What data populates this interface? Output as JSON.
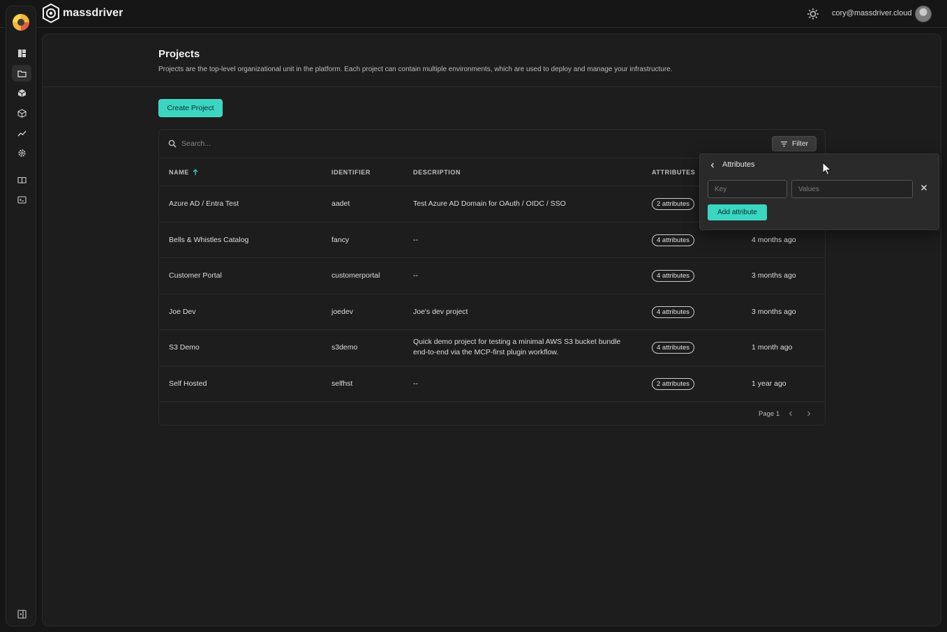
{
  "app": {
    "brand": "massdriver"
  },
  "topbar": {
    "user_email": "cory@massdriver.cloud"
  },
  "page": {
    "title": "Projects",
    "description": "Projects are the top-level organizational unit in the platform. Each project can contain multiple environments, which are used to deploy and manage your infrastructure.",
    "create_label": "Create Project"
  },
  "search": {
    "placeholder": "Search..."
  },
  "filter": {
    "label": "Filter"
  },
  "table": {
    "columns": {
      "name": "NAME",
      "identifier": "IDENTIFIER",
      "description": "DESCRIPTION",
      "attributes": "ATTRIBUTES"
    },
    "rows": [
      {
        "name": "Azure AD / Entra Test",
        "identifier": "aadet",
        "description": "Test Azure AD Domain for OAuth / OIDC / SSO",
        "attributes": "2 attributes",
        "updated": ""
      },
      {
        "name": "Bells & Whistles Catalog",
        "identifier": "fancy",
        "description": "--",
        "attributes": "4 attributes",
        "updated": "4 months ago"
      },
      {
        "name": "Customer Portal",
        "identifier": "customerportal",
        "description": "--",
        "attributes": "4 attributes",
        "updated": "3 months ago"
      },
      {
        "name": "Joe Dev",
        "identifier": "joedev",
        "description": "Joe's dev project",
        "attributes": "4 attributes",
        "updated": "3 months ago"
      },
      {
        "name": "S3 Demo",
        "identifier": "s3demo",
        "description": "Quick demo project for testing a minimal AWS S3 bucket bundle end-to-end via the MCP-first plugin workflow.",
        "attributes": "4 attributes",
        "updated": "1 month ago"
      },
      {
        "name": "Self Hosted",
        "identifier": "selfhst",
        "description": "--",
        "attributes": "2 attributes",
        "updated": "1 year ago"
      }
    ],
    "page_label": "Page 1"
  },
  "popover": {
    "title": "Attributes",
    "key_placeholder": "Key",
    "values_placeholder": "Values",
    "add_label": "Add attribute"
  },
  "colors": {
    "accent": "#3ad6c2",
    "background": "#161616",
    "panel": "#1d1d1d"
  },
  "icons": [
    "theme-toggle-icon",
    "dashboard-icon",
    "projects-folder-icon",
    "bundles-icon",
    "package-icon",
    "metrics-icon",
    "settings-icon",
    "docs-icon",
    "terminal-icon",
    "collapse-sidebar-icon",
    "search-icon",
    "filter-icon",
    "sort-asc-icon",
    "chevron-left-icon",
    "chevron-right-icon",
    "close-icon",
    "cursor-icon"
  ]
}
